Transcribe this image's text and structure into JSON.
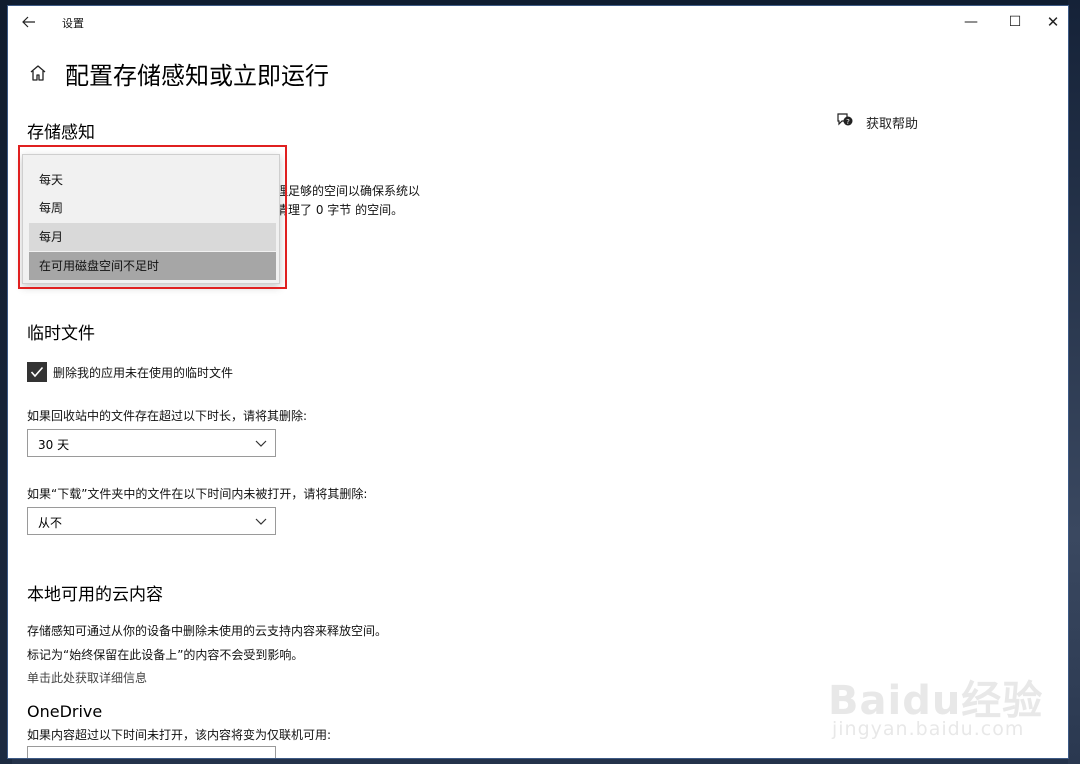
{
  "window": {
    "app_title": "设置",
    "back_icon": "back-arrow-icon",
    "minimize_glyph": "—",
    "maximize_glyph": "☐",
    "close_glyph": "✕"
  },
  "header": {
    "home_icon": "home-icon",
    "title": "配置存储感知或立即运行"
  },
  "help": {
    "icon": "help-chat-icon",
    "label": "获取帮助"
  },
  "storage_sense": {
    "heading": "存储感知",
    "description_line1_partial": "理足够的空间以确保系统以",
    "description_line2_partial": "清理了 0 字节 的空间。",
    "run_frequency_dropdown": {
      "options": [
        "每天",
        "每周",
        "每月",
        "在可用磁盘空间不足时"
      ],
      "hovered_option": "每月",
      "selected_option": "在可用磁盘空间不足时",
      "highlight_color": "#e02020"
    }
  },
  "temp_files": {
    "heading": "临时文件",
    "delete_temp_checkbox": {
      "label": "删除我的应用未在使用的临时文件",
      "checked": true
    },
    "recycle_bin_label": "如果回收站中的文件存在超过以下时长，请将其删除:",
    "recycle_bin_value": "30 天",
    "downloads_label": "如果“下载”文件夹中的文件在以下时间内未被打开，请将其删除:",
    "downloads_value": "从不"
  },
  "cloud_content": {
    "heading": "本地可用的云内容",
    "description": "存储感知可通过从你的设备中删除未使用的云支持内容来释放空间。",
    "note": "标记为“始终保留在此设备上”的内容不会受到影响。",
    "more_info_link": "单击此处获取详细信息",
    "onedrive": {
      "heading": "OneDrive",
      "label": "如果内容超过以下时间未打开，该内容将变为仅联机可用:"
    }
  },
  "watermark": {
    "brand": "Baidu经验",
    "url": "jingyan.baidu.com"
  },
  "colors": {
    "accent_dark": "#333333",
    "window_bg": "#ffffff",
    "dropdown_bg": "#f1f1f1",
    "selected_bg": "#a6a6a6"
  }
}
